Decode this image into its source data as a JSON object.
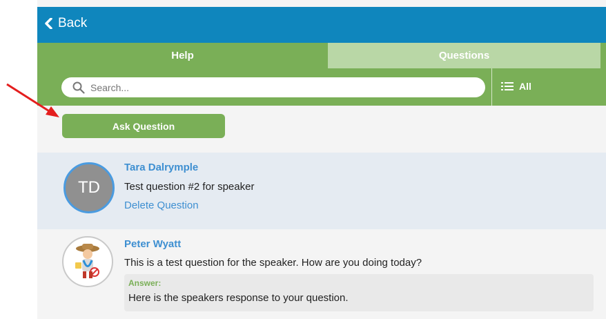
{
  "header": {
    "back_label": "Back"
  },
  "tabs": [
    {
      "label": "Help",
      "active": true
    },
    {
      "label": "Questions",
      "active": false
    }
  ],
  "search": {
    "placeholder": "Search..."
  },
  "filter": {
    "label": "All"
  },
  "ask_button": {
    "label": "Ask Question"
  },
  "questions": [
    {
      "name": "Tara Dalrymple",
      "initials": "TD",
      "text": "Test question #2 for speaker",
      "action": "Delete Question"
    },
    {
      "name": "Peter Wyatt",
      "text": "This is a test question for the speaker. How are you doing today?",
      "answer_label": "Answer:",
      "answer_text": "Here is the speakers response to your question."
    }
  ],
  "colors": {
    "header": "#0f86bd",
    "green": "#7aaf57",
    "light_green": "#b9d7a6",
    "link": "#3e8fd1",
    "annotation_arrow": "#e41e1e"
  }
}
